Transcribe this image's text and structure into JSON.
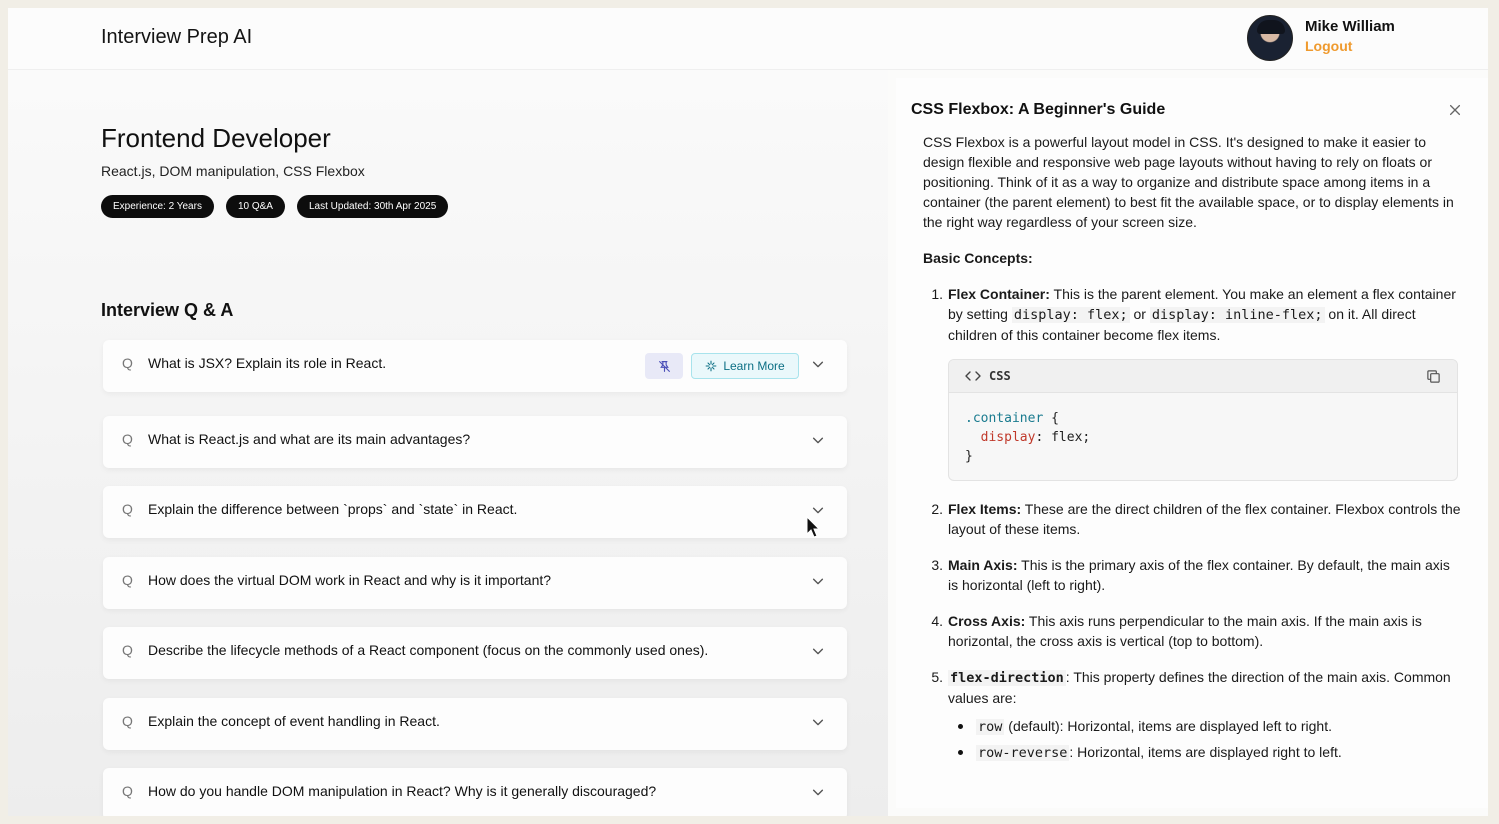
{
  "app": {
    "title": "Interview Prep AI"
  },
  "user": {
    "name": "Mike William",
    "logout_label": "Logout"
  },
  "session": {
    "role": "Frontend Developer",
    "topics": "React.js, DOM manipulation, CSS Flexbox",
    "pills": [
      "Experience: 2 Years",
      "10 Q&A",
      "Last Updated: 30th Apr 2025"
    ]
  },
  "qa": {
    "heading": "Interview Q & A",
    "q_marker": "Q",
    "learn_more_label": "Learn More",
    "items": [
      "What is JSX? Explain its role in React.",
      "What is React.js and what are its main advantages?",
      "Explain the difference between `props` and `state` in React.",
      "How does the virtual DOM work in React and why is it important?",
      "Describe the lifecycle methods of a React component (focus on the commonly used ones).",
      "Explain the concept of event handling in React.",
      "How do you handle DOM manipulation in React? Why is it generally discouraged?"
    ]
  },
  "drawer": {
    "title": "CSS Flexbox: A Beginner's Guide",
    "intro": "CSS Flexbox is a powerful layout model in CSS. It's designed to make it easier to design flexible and responsive web page layouts without having to rely on floats or positioning. Think of it as a way to organize and distribute space among items in a container (the parent element) to best fit the available space, or to display elements in the right way regardless of your screen size.",
    "basic_heading": "Basic Concepts:",
    "item1": {
      "num": "1.",
      "term": "Flex Container:",
      "t1": " This is the parent element. You make an element a flex container by setting ",
      "code1": "display: flex;",
      "t2": " or ",
      "code2": "display: inline-flex;",
      "t3": " on it. All direct children of this container become flex items."
    },
    "code_block": {
      "lang": "CSS",
      "line1_sel": ".container",
      "line1_rest": " {",
      "line2_prop": "display",
      "line2_rest": ": flex;",
      "line3": "}"
    },
    "item2": {
      "num": "2.",
      "term": "Flex Items:",
      "text": " These are the direct children of the flex container. Flexbox controls the layout of these items."
    },
    "item3": {
      "num": "3.",
      "term": "Main Axis:",
      "text": " This is the primary axis of the flex container. By default, the main axis is horizontal (left to right)."
    },
    "item4": {
      "num": "4.",
      "term": "Cross Axis:",
      "text": " This axis runs perpendicular to the main axis. If the main axis is horizontal, the cross axis is vertical (top to bottom)."
    },
    "item5": {
      "num": "5.",
      "code": "flex-direction",
      "text": ": This property defines the direction of the main axis. Common values are:"
    },
    "sub_items": [
      {
        "code": "row",
        "text": " (default): Horizontal, items are displayed left to right."
      },
      {
        "code": "row-reverse",
        "text": ": Horizontal, items are displayed right to left."
      }
    ]
  }
}
